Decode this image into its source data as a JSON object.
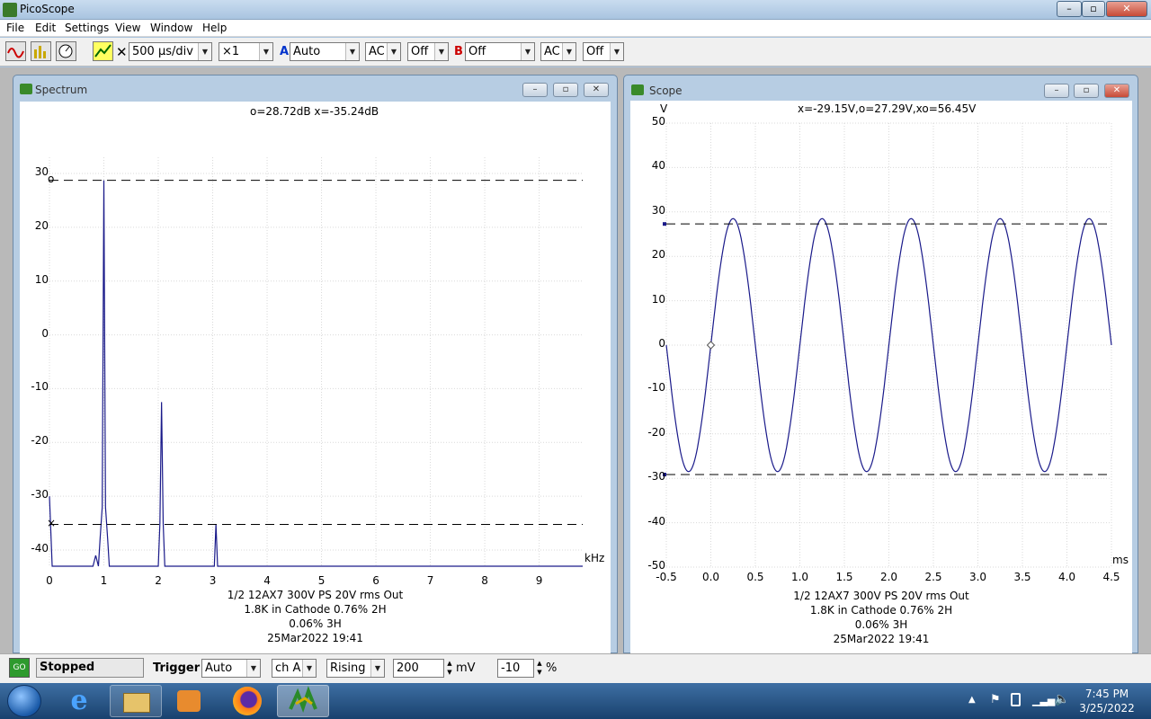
{
  "window": {
    "title": "PicoScope"
  },
  "menu": [
    "File",
    "Edit",
    "Settings",
    "View",
    "Window",
    "Help"
  ],
  "toolbar": {
    "timebase": "500 µs/div",
    "multiplier": "×1",
    "channel_a_letter": "A",
    "channel_a_range": "Auto",
    "channel_a_coupling": "AC",
    "channel_a_extra": "Off",
    "channel_b_letter": "B",
    "channel_b_range": "Off",
    "channel_b_coupling": "AC",
    "channel_b_extra": "Off",
    "x_mark": "✕"
  },
  "spectrum": {
    "title": "Spectrum",
    "header": "o=28.72dB  x=-35.24dB",
    "x_unit": "kHz",
    "caption": [
      "1/2 12AX7 300V PS 20V rms Out",
      "1.8K in Cathode  0.76% 2H",
      "0.06% 3H",
      "25Mar2022  19:41"
    ],
    "cursor_o_label": "o",
    "cursor_x_label": "×"
  },
  "scope": {
    "title": "Scope",
    "y_unit": "V",
    "header": "x=-29.15V,o=27.29V,xo=56.45V",
    "x_unit": "ms",
    "caption": [
      "1/2 12AX7 300V PS 20V rms Out",
      "1.8K in Cathode  0.76% 2H",
      "0.06% 3H",
      "25Mar2022  19:41"
    ]
  },
  "chart_data": [
    {
      "type": "line",
      "title": "o=28.72dB  x=-35.24dB",
      "xlabel": "kHz",
      "ylabel": "",
      "xlim": [
        0,
        9.8
      ],
      "ylim": [
        -43,
        33
      ],
      "x_ticks": [
        "0",
        "1",
        "2",
        "3",
        "4",
        "5",
        "6",
        "7",
        "8",
        "9"
      ],
      "y_ticks": [
        "30",
        "20",
        "10",
        "0",
        "-10",
        "-20",
        "-30",
        "-40"
      ],
      "grid": true,
      "series": [
        {
          "points": [
            [
              0,
              -30
            ],
            [
              0.05,
              -43
            ],
            [
              0.8,
              -43
            ],
            [
              0.85,
              -41
            ],
            [
              0.9,
              -43
            ],
            [
              0.93,
              -38
            ],
            [
              0.97,
              -32
            ],
            [
              1.0,
              28.72
            ],
            [
              1.03,
              -32
            ],
            [
              1.07,
              -38
            ],
            [
              1.1,
              -43
            ],
            [
              2.0,
              -43
            ],
            [
              2.03,
              -35
            ],
            [
              2.06,
              -12.5
            ],
            [
              2.09,
              -35
            ],
            [
              2.12,
              -43
            ],
            [
              3.03,
              -43
            ],
            [
              3.06,
              -35.2
            ],
            [
              3.09,
              -43
            ],
            [
              9.8,
              -43
            ]
          ]
        }
      ],
      "cursors": [
        {
          "label": "o",
          "value": 28.72
        },
        {
          "label": "x",
          "value": -35.24
        }
      ]
    },
    {
      "type": "line",
      "title": "x=-29.15V,o=27.29V,xo=56.45V",
      "xlabel": "ms",
      "ylabel": "V",
      "xlim": [
        -0.5,
        4.5
      ],
      "ylim": [
        -50,
        50
      ],
      "x_ticks": [
        "-0.5",
        "0.0",
        "0.5",
        "1.0",
        "1.5",
        "2.0",
        "2.5",
        "3.0",
        "3.5",
        "4.0",
        "4.5"
      ],
      "y_ticks": [
        "50",
        "40",
        "30",
        "20",
        "10",
        "0",
        "-10",
        "-20",
        "-30",
        "-40",
        "-50"
      ],
      "grid": true,
      "series": [
        {
          "waveform": "sine",
          "amplitude_v": 28.5,
          "frequency_khz": 1.0,
          "phase_zero_ms": 0.0
        }
      ],
      "cursors": [
        {
          "label": "o",
          "value": 27.29
        },
        {
          "label": "x",
          "value": -29.15
        }
      ]
    }
  ],
  "statusbar": {
    "go_label": "GO",
    "state": "Stopped",
    "trigger_label": "Trigger",
    "trigger_mode": "Auto",
    "trigger_channel": "ch A",
    "trigger_edge": "Rising",
    "trigger_level": "200",
    "trigger_unit": "mV",
    "pretrigger": "-10",
    "pretrigger_unit": "%"
  },
  "taskbar": {
    "time": "7:45 PM",
    "date": "3/25/2022"
  }
}
